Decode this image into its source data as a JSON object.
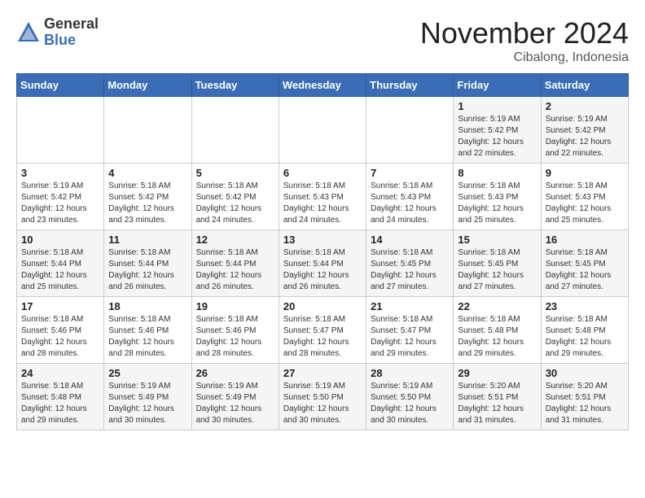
{
  "logo": {
    "general": "General",
    "blue": "Blue"
  },
  "title": "November 2024",
  "location": "Cibalong, Indonesia",
  "days_of_week": [
    "Sunday",
    "Monday",
    "Tuesday",
    "Wednesday",
    "Thursday",
    "Friday",
    "Saturday"
  ],
  "weeks": [
    [
      {
        "day": "",
        "info": ""
      },
      {
        "day": "",
        "info": ""
      },
      {
        "day": "",
        "info": ""
      },
      {
        "day": "",
        "info": ""
      },
      {
        "day": "",
        "info": ""
      },
      {
        "day": "1",
        "info": "Sunrise: 5:19 AM\nSunset: 5:42 PM\nDaylight: 12 hours and 22 minutes."
      },
      {
        "day": "2",
        "info": "Sunrise: 5:19 AM\nSunset: 5:42 PM\nDaylight: 12 hours and 22 minutes."
      }
    ],
    [
      {
        "day": "3",
        "info": "Sunrise: 5:19 AM\nSunset: 5:42 PM\nDaylight: 12 hours and 23 minutes."
      },
      {
        "day": "4",
        "info": "Sunrise: 5:18 AM\nSunset: 5:42 PM\nDaylight: 12 hours and 23 minutes."
      },
      {
        "day": "5",
        "info": "Sunrise: 5:18 AM\nSunset: 5:42 PM\nDaylight: 12 hours and 24 minutes."
      },
      {
        "day": "6",
        "info": "Sunrise: 5:18 AM\nSunset: 5:43 PM\nDaylight: 12 hours and 24 minutes."
      },
      {
        "day": "7",
        "info": "Sunrise: 5:18 AM\nSunset: 5:43 PM\nDaylight: 12 hours and 24 minutes."
      },
      {
        "day": "8",
        "info": "Sunrise: 5:18 AM\nSunset: 5:43 PM\nDaylight: 12 hours and 25 minutes."
      },
      {
        "day": "9",
        "info": "Sunrise: 5:18 AM\nSunset: 5:43 PM\nDaylight: 12 hours and 25 minutes."
      }
    ],
    [
      {
        "day": "10",
        "info": "Sunrise: 5:18 AM\nSunset: 5:44 PM\nDaylight: 12 hours and 25 minutes."
      },
      {
        "day": "11",
        "info": "Sunrise: 5:18 AM\nSunset: 5:44 PM\nDaylight: 12 hours and 26 minutes."
      },
      {
        "day": "12",
        "info": "Sunrise: 5:18 AM\nSunset: 5:44 PM\nDaylight: 12 hours and 26 minutes."
      },
      {
        "day": "13",
        "info": "Sunrise: 5:18 AM\nSunset: 5:44 PM\nDaylight: 12 hours and 26 minutes."
      },
      {
        "day": "14",
        "info": "Sunrise: 5:18 AM\nSunset: 5:45 PM\nDaylight: 12 hours and 27 minutes."
      },
      {
        "day": "15",
        "info": "Sunrise: 5:18 AM\nSunset: 5:45 PM\nDaylight: 12 hours and 27 minutes."
      },
      {
        "day": "16",
        "info": "Sunrise: 5:18 AM\nSunset: 5:45 PM\nDaylight: 12 hours and 27 minutes."
      }
    ],
    [
      {
        "day": "17",
        "info": "Sunrise: 5:18 AM\nSunset: 5:46 PM\nDaylight: 12 hours and 28 minutes."
      },
      {
        "day": "18",
        "info": "Sunrise: 5:18 AM\nSunset: 5:46 PM\nDaylight: 12 hours and 28 minutes."
      },
      {
        "day": "19",
        "info": "Sunrise: 5:18 AM\nSunset: 5:46 PM\nDaylight: 12 hours and 28 minutes."
      },
      {
        "day": "20",
        "info": "Sunrise: 5:18 AM\nSunset: 5:47 PM\nDaylight: 12 hours and 28 minutes."
      },
      {
        "day": "21",
        "info": "Sunrise: 5:18 AM\nSunset: 5:47 PM\nDaylight: 12 hours and 29 minutes."
      },
      {
        "day": "22",
        "info": "Sunrise: 5:18 AM\nSunset: 5:48 PM\nDaylight: 12 hours and 29 minutes."
      },
      {
        "day": "23",
        "info": "Sunrise: 5:18 AM\nSunset: 5:48 PM\nDaylight: 12 hours and 29 minutes."
      }
    ],
    [
      {
        "day": "24",
        "info": "Sunrise: 5:18 AM\nSunset: 5:48 PM\nDaylight: 12 hours and 29 minutes."
      },
      {
        "day": "25",
        "info": "Sunrise: 5:19 AM\nSunset: 5:49 PM\nDaylight: 12 hours and 30 minutes."
      },
      {
        "day": "26",
        "info": "Sunrise: 5:19 AM\nSunset: 5:49 PM\nDaylight: 12 hours and 30 minutes."
      },
      {
        "day": "27",
        "info": "Sunrise: 5:19 AM\nSunset: 5:50 PM\nDaylight: 12 hours and 30 minutes."
      },
      {
        "day": "28",
        "info": "Sunrise: 5:19 AM\nSunset: 5:50 PM\nDaylight: 12 hours and 30 minutes."
      },
      {
        "day": "29",
        "info": "Sunrise: 5:20 AM\nSunset: 5:51 PM\nDaylight: 12 hours and 31 minutes."
      },
      {
        "day": "30",
        "info": "Sunrise: 5:20 AM\nSunset: 5:51 PM\nDaylight: 12 hours and 31 minutes."
      }
    ]
  ]
}
